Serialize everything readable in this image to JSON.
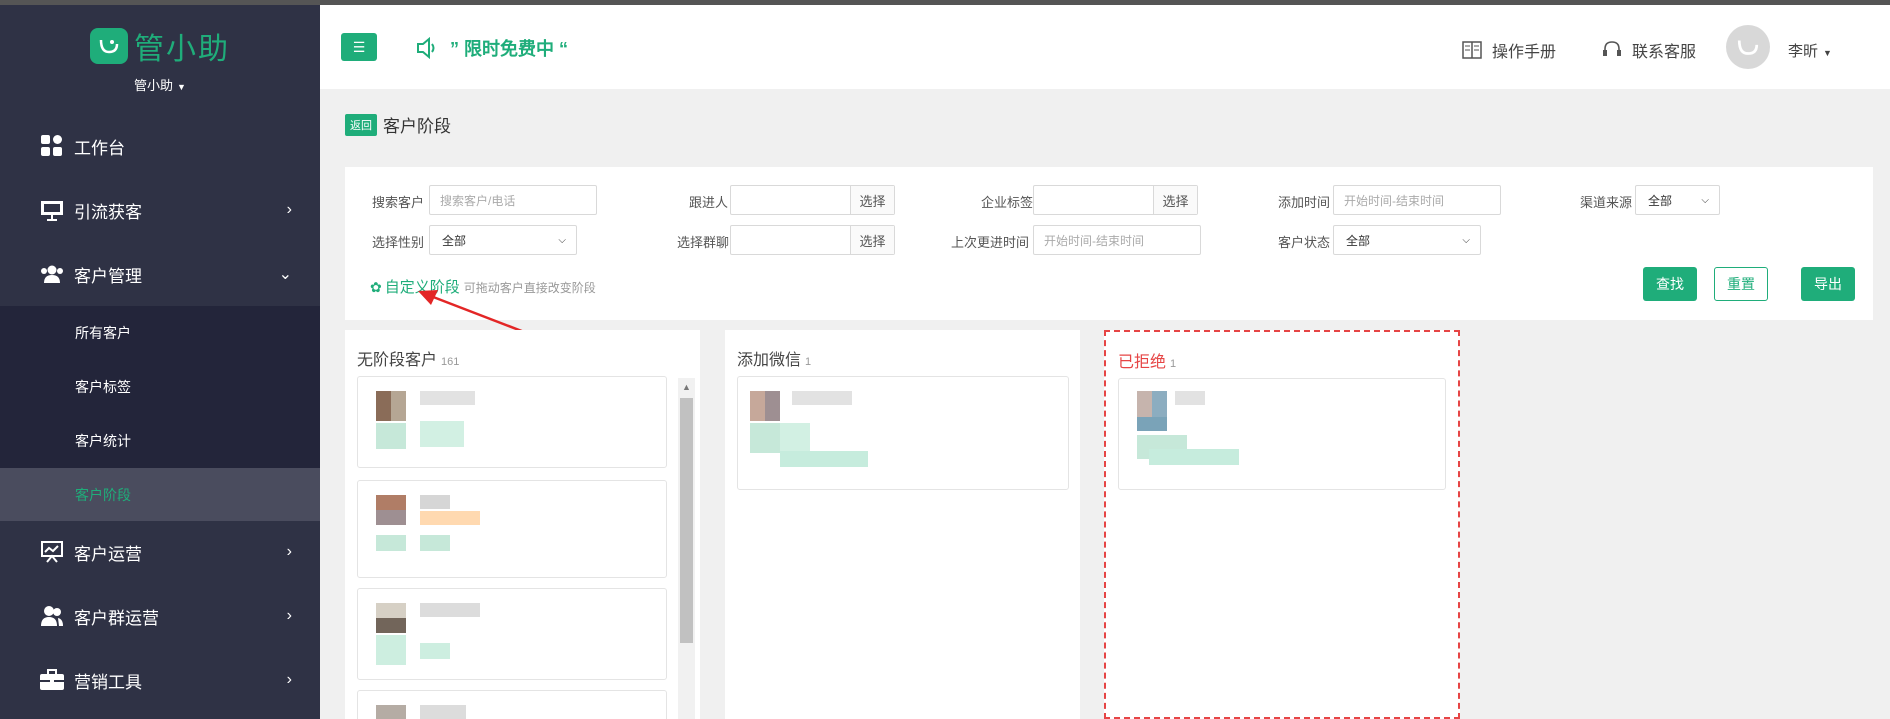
{
  "brand": {
    "logo_text": "管小助",
    "sub_label": "管小助"
  },
  "sidebar": {
    "items": [
      {
        "label": "工作台",
        "icon": "dashboard-icon"
      },
      {
        "label": "引流获客",
        "icon": "monitor-icon"
      },
      {
        "label": "客户管理",
        "icon": "users-icon"
      },
      {
        "label": "客户运营",
        "icon": "presentation-icon"
      },
      {
        "label": "客户群运营",
        "icon": "group-icon"
      },
      {
        "label": "营销工具",
        "icon": "briefcase-icon"
      }
    ],
    "submenu": [
      {
        "label": "所有客户"
      },
      {
        "label": "客户标签"
      },
      {
        "label": "客户统计"
      },
      {
        "label": "客户阶段"
      }
    ]
  },
  "header": {
    "promo": "” 限时免费中 “",
    "manual": "操作手册",
    "support": "联系客服",
    "user": "李昕"
  },
  "page": {
    "back_label": "返回",
    "title": "客户阶段"
  },
  "filters": {
    "search_label": "搜索客户",
    "search_placeholder": "搜索客户/电话",
    "owner_label": "跟进人",
    "choose": "选择",
    "tag_label": "企业标签",
    "add_time_label": "添加时间",
    "add_time_placeholder": "开始时间-结束时间",
    "channel_label": "渠道来源",
    "channel_value": "全部",
    "gender_label": "选择性别",
    "gender_value": "全部",
    "group_label": "选择群聊",
    "last_follow_label": "上次更进时间",
    "last_follow_placeholder": "开始时间-结束时间",
    "status_label": "客户状态",
    "status_value": "全部",
    "custom_stage": "自定义阶段",
    "custom_stage_hint": "可拖动客户直接改变阶段",
    "search_btn": "查找",
    "reset_btn": "重置",
    "export_btn": "导出"
  },
  "columns": [
    {
      "title": "无阶段客户",
      "count": "161"
    },
    {
      "title": "添加微信",
      "count": "1"
    },
    {
      "title": "已拒绝",
      "count": "1"
    }
  ],
  "colors": {
    "accent": "#1fad7a",
    "sidebar_bg": "#2f3245",
    "reject": "#e64545"
  }
}
